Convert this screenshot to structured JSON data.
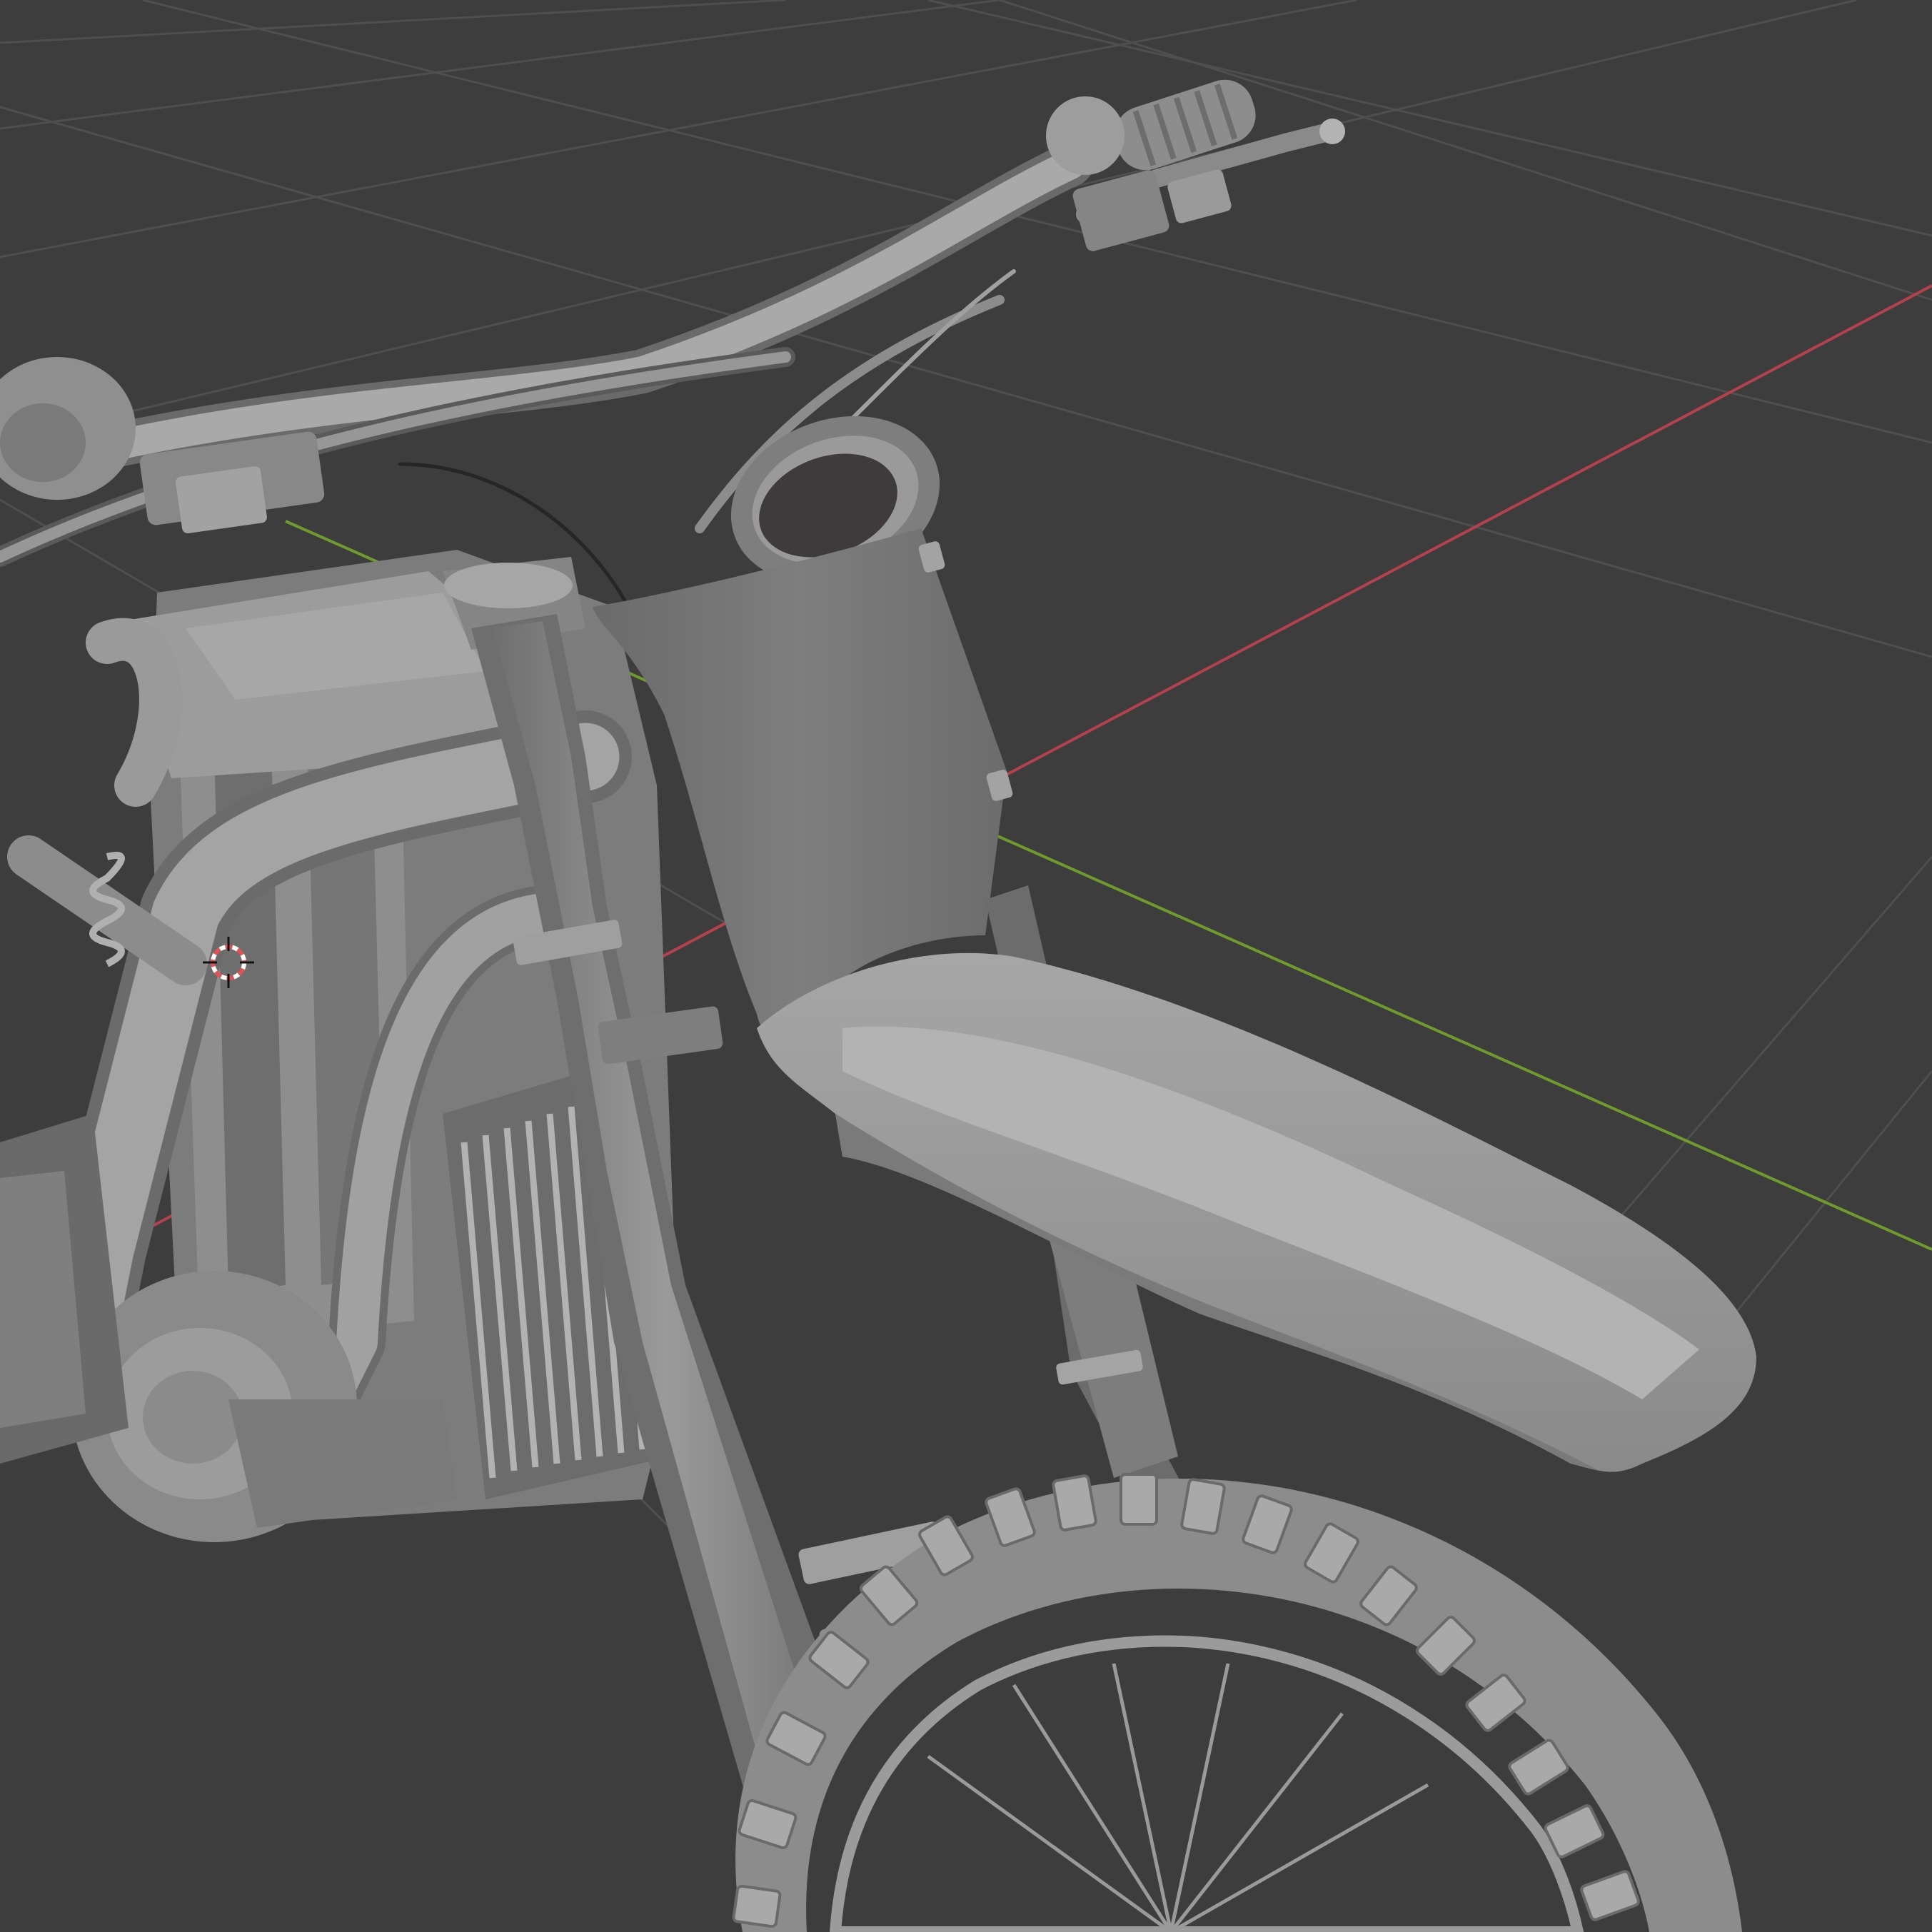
{
  "viewport": {
    "background": "#3d3d3d",
    "grid_color": "#4e4e4e",
    "x_axis_color": "#b5414e",
    "y_axis_color": "#6f9b2c",
    "model_base": "#8f8f8f",
    "model_light": "#a8a8a8",
    "model_dark": "#5e5e5e",
    "model_shadow": "#444444",
    "cursor_color": "#e05353"
  },
  "scene": {
    "object": "motorcycle-3d-model",
    "visible_text": []
  }
}
